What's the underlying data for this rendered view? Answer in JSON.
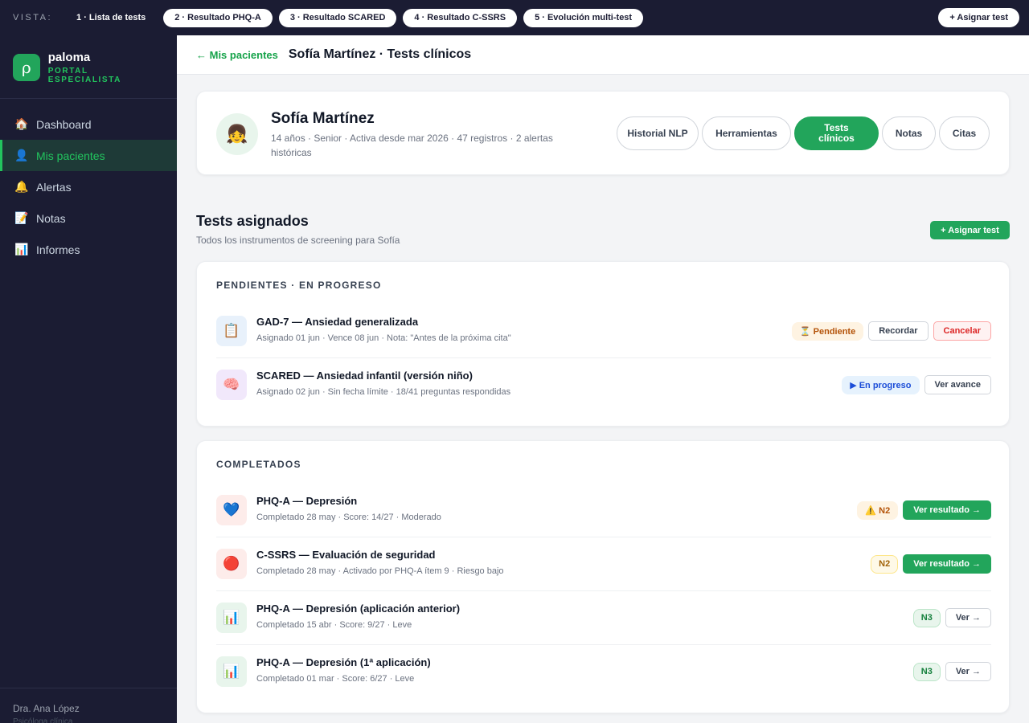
{
  "viewbar": {
    "label": "VISTA:",
    "tabs": [
      {
        "label": "1 · Lista de tests",
        "active": true
      },
      {
        "label": "2 · Resultado PHQ-A",
        "active": false
      },
      {
        "label": "3 · Resultado SCARED",
        "active": false
      },
      {
        "label": "4 · Resultado C-SSRS",
        "active": false
      },
      {
        "label": "5 · Evolución multi-test",
        "active": false
      }
    ],
    "assign_label": "+ Asignar test"
  },
  "brand": {
    "name": "paloma",
    "subtitle": "PORTAL ESPECIALISTA",
    "logo_glyph": "ρ"
  },
  "sidebar": {
    "items": [
      {
        "label": "Dashboard",
        "icon": "house-icon",
        "glyph": "🏠",
        "active": false
      },
      {
        "label": "Mis pacientes",
        "icon": "user-icon",
        "glyph": "👤",
        "active": true
      },
      {
        "label": "Alertas",
        "icon": "bell-icon",
        "glyph": "🔔",
        "active": false
      },
      {
        "label": "Notas",
        "icon": "memo-icon",
        "glyph": "📝",
        "active": false
      },
      {
        "label": "Informes",
        "icon": "bar-chart-icon",
        "glyph": "📊",
        "active": false
      }
    ],
    "user": {
      "name": "Dra. Ana López",
      "role": "Psicóloga clínica"
    }
  },
  "header": {
    "back_label": "← Mis pacientes",
    "title": "Sofía Martínez · Tests clínicos"
  },
  "patient": {
    "avatar_glyph": "👧",
    "name": "Sofía Martínez",
    "meta": "14 años · Senior · Activa desde mar 2026 · 47 registros · 2 alertas históricas",
    "tabs": [
      {
        "label": "Historial NLP",
        "active": false
      },
      {
        "label": "Herramientas",
        "active": false
      },
      {
        "label": "Tests clínicos",
        "active": true
      },
      {
        "label": "Notas",
        "active": false
      },
      {
        "label": "Citas",
        "active": false
      }
    ]
  },
  "section": {
    "title": "Tests asignados",
    "subtitle": "Todos los instrumentos de screening para Sofía",
    "assign_label": "+ Asignar test"
  },
  "pending": {
    "title": "PENDIENTES · EN PROGRESO",
    "rows": [
      {
        "icon": "clipboard-icon",
        "glyph": "📋",
        "icon_bg": "#e8f1fb",
        "name": "GAD-7 — Ansiedad generalizada",
        "meta": "Asignado 01 jun · Vence 08 jun · Nota: \"Antes de la próxima cita\"",
        "badge": {
          "label": "⏳ Pendiente",
          "bg": "#fef3e2",
          "color": "#b45309"
        },
        "buttons": [
          {
            "label": "Recordar",
            "style": "plain"
          },
          {
            "label": "Cancelar",
            "style": "danger"
          }
        ]
      },
      {
        "icon": "brain-icon",
        "glyph": "🧠",
        "icon_bg": "#f1e8fb",
        "name": "SCARED — Ansiedad infantil (versión niño)",
        "meta": "Asignado 02 jun · Sin fecha límite · 18/41 preguntas respondidas",
        "badge": {
          "label": "▶ En progreso",
          "bg": "#e6f2fd",
          "color": "#1d4ed8"
        },
        "buttons": [
          {
            "label": "Ver avance",
            "style": "plain"
          }
        ]
      }
    ]
  },
  "completed": {
    "title": "COMPLETADOS",
    "rows": [
      {
        "icon": "blue-heart-icon",
        "glyph": "💙",
        "icon_bg": "#fdecea",
        "name": "PHQ-A — Depresión",
        "meta": "Completado 28 may · Score: 14/27 · Moderado",
        "badge": {
          "label": "⚠️ N2",
          "bg": "#fef3e2",
          "color": "#b45309",
          "border": "#fef3e2"
        },
        "button": {
          "label": "Ver resultado →",
          "style": "green"
        }
      },
      {
        "icon": "red-circle-icon",
        "glyph": "🔴",
        "icon_bg": "#fdecea",
        "name": "C-SSRS — Evaluación de seguridad",
        "meta": "Completado 28 may · Activado por PHQ-A ítem 9 · Riesgo bajo",
        "badge": {
          "label": "N2",
          "bg": "#fef9e7",
          "color": "#a16207",
          "border": "#fde68a"
        },
        "button": {
          "label": "Ver resultado →",
          "style": "green"
        }
      },
      {
        "icon": "bar-chart-icon",
        "glyph": "📊",
        "icon_bg": "#e8f5ec",
        "name": "PHQ-A — Depresión (aplicación anterior)",
        "meta": "Completado 15 abr · Score: 9/27 · Leve",
        "badge": {
          "label": "N3",
          "bg": "#e8f5ec",
          "color": "#15803d",
          "border": "#bbe5c8"
        },
        "button": {
          "label": "Ver →",
          "style": "plain"
        }
      },
      {
        "icon": "bar-chart-icon",
        "glyph": "📊",
        "icon_bg": "#e8f5ec",
        "name": "PHQ-A — Depresión (1ª aplicación)",
        "meta": "Completado 01 mar · Score: 6/27 · Leve",
        "badge": {
          "label": "N3",
          "bg": "#e8f5ec",
          "color": "#15803d",
          "border": "#bbe5c8"
        },
        "button": {
          "label": "Ver →",
          "style": "plain"
        }
      }
    ]
  },
  "colors": {
    "accent": "#22a55b",
    "navy": "#1b1c33"
  }
}
